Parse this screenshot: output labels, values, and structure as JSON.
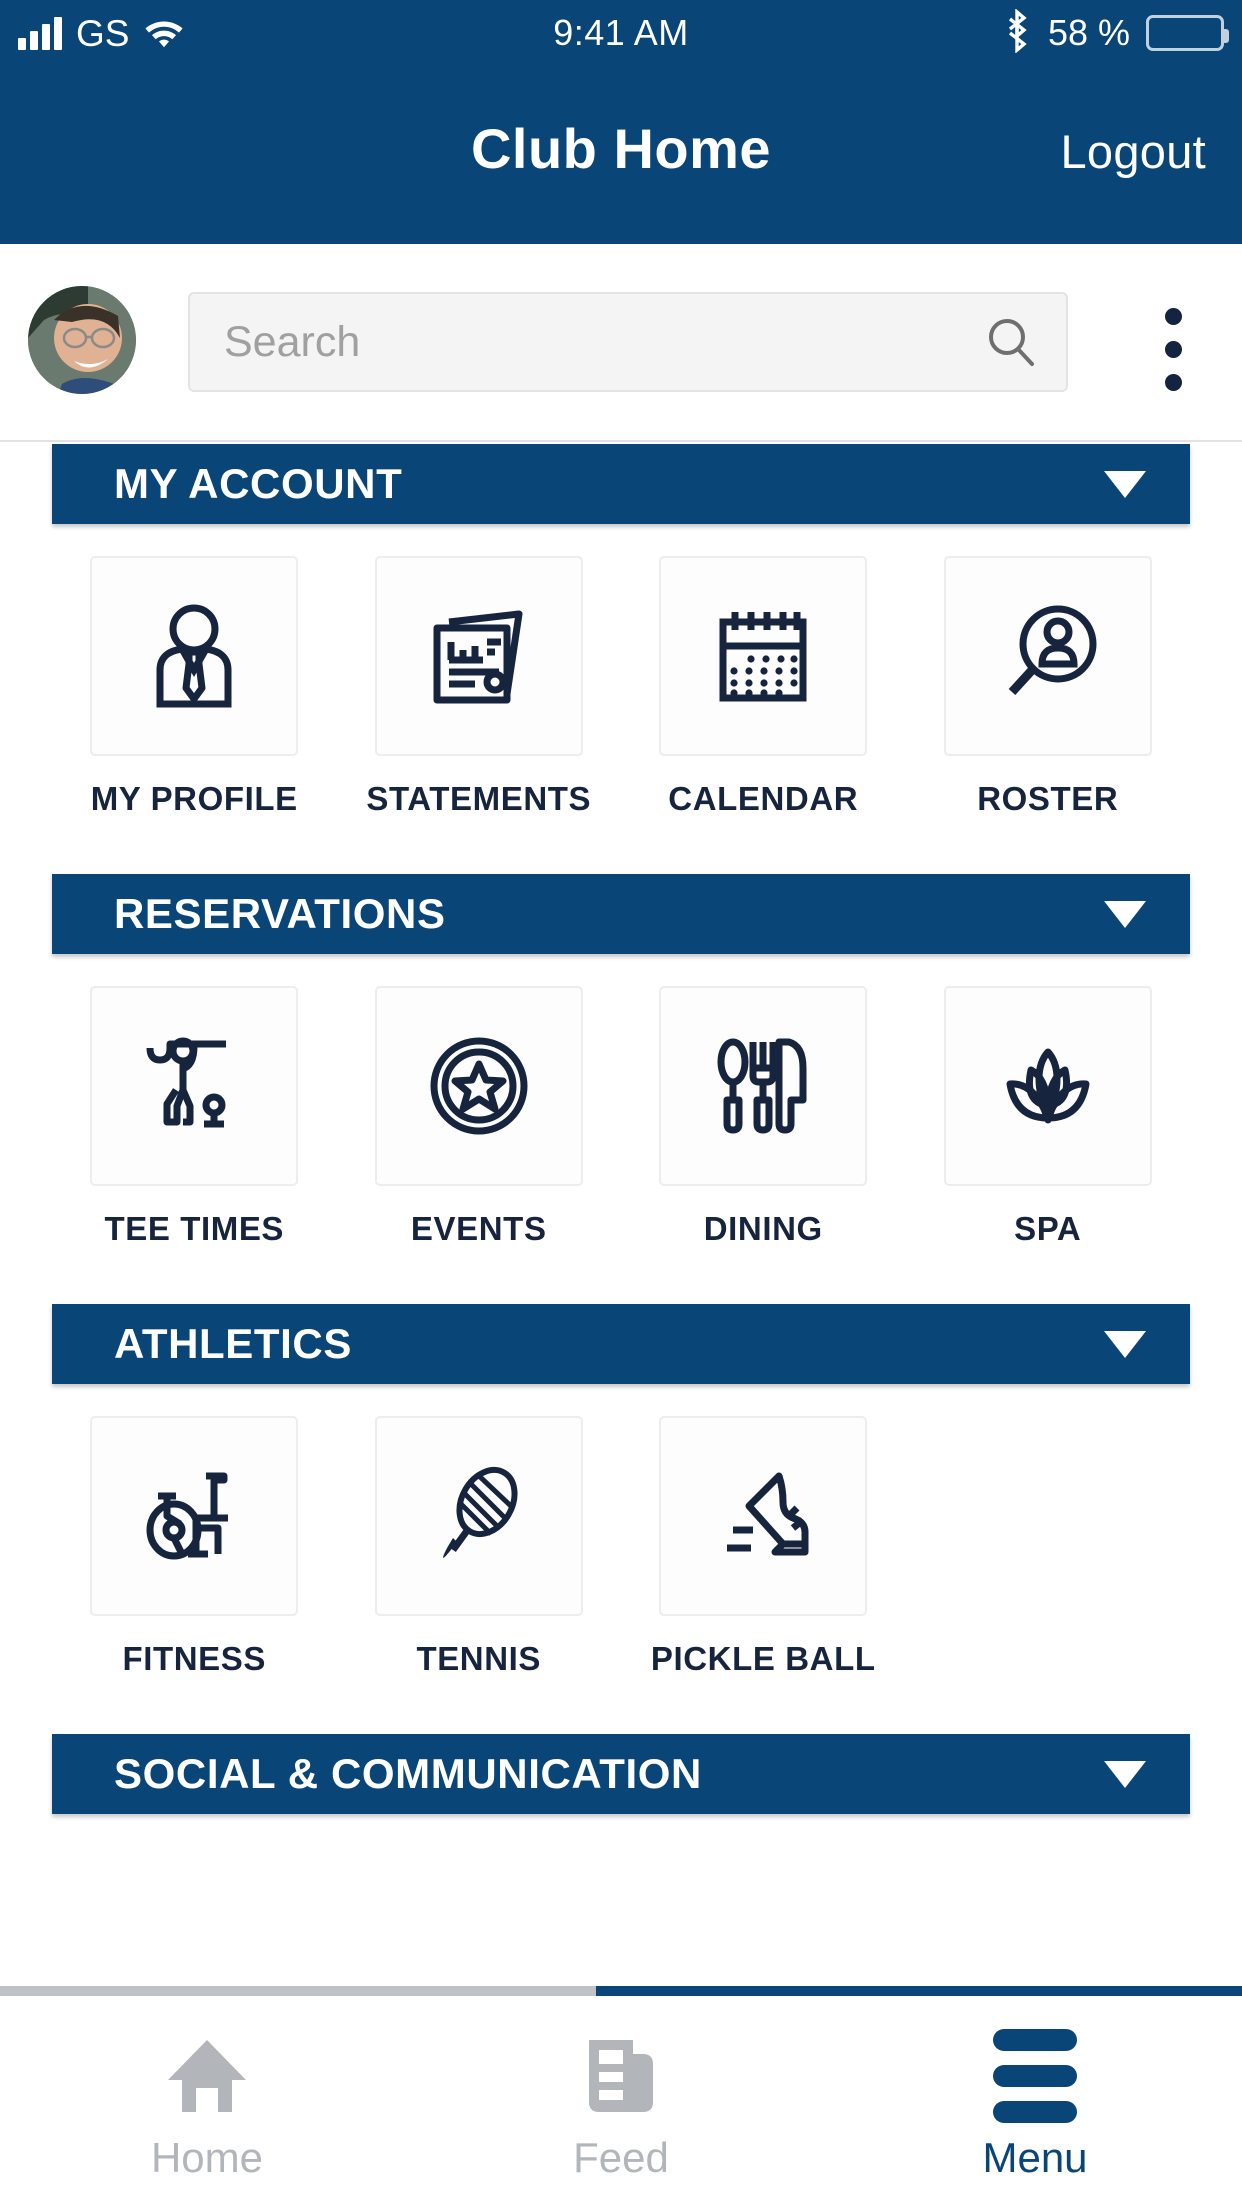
{
  "status_bar": {
    "carrier": "GS",
    "signal_icon": "signal-bars-icon",
    "wifi_icon": "wifi-icon",
    "time": "9:41 AM",
    "bluetooth_icon": "bluetooth-icon",
    "battery_percent": "58 %",
    "battery_level": 58,
    "battery_icon": "battery-icon"
  },
  "navbar": {
    "title": "Club Home",
    "logout_label": "Logout"
  },
  "search_row": {
    "avatar_name": "user-avatar",
    "search_placeholder": "Search",
    "search_value": "",
    "search_icon": "search-icon",
    "overflow_icon": "kebab-menu-icon"
  },
  "sections": [
    {
      "title": "MY ACCOUNT",
      "caret_icon": "chevron-down-icon",
      "expanded": true,
      "tiles": [
        {
          "label": "MY PROFILE",
          "icon": "person-tie-icon"
        },
        {
          "label": "STATEMENTS",
          "icon": "documents-chart-icon"
        },
        {
          "label": "CALENDAR",
          "icon": "calendar-icon"
        },
        {
          "label": "ROSTER",
          "icon": "magnifier-person-icon"
        }
      ]
    },
    {
      "title": "RESERVATIONS",
      "caret_icon": "chevron-down-icon",
      "expanded": true,
      "tiles": [
        {
          "label": "TEE TIMES",
          "icon": "golfer-icon"
        },
        {
          "label": "EVENTS",
          "icon": "star-badge-icon"
        },
        {
          "label": "DINING",
          "icon": "cutlery-icon"
        },
        {
          "label": "SPA",
          "icon": "lotus-icon"
        }
      ]
    },
    {
      "title": "ATHLETICS",
      "caret_icon": "chevron-down-icon",
      "expanded": true,
      "tiles": [
        {
          "label": "FITNESS",
          "icon": "exercise-bike-icon"
        },
        {
          "label": "TENNIS",
          "icon": "tennis-racket-icon"
        },
        {
          "label": "PICKLE BALL",
          "icon": "running-shoe-icon"
        }
      ]
    },
    {
      "title": "SOCIAL & COMMUNICATION",
      "caret_icon": "chevron-down-icon",
      "expanded": true,
      "tiles": []
    }
  ],
  "tabbar": {
    "tabs": [
      {
        "label": "Home",
        "icon": "home-icon",
        "active": false
      },
      {
        "label": "Feed",
        "icon": "feed-icon",
        "active": false
      },
      {
        "label": "Menu",
        "icon": "hamburger-menu-icon",
        "active": true
      }
    ]
  },
  "colors": {
    "brand_blue": "#0a4578",
    "icon_navy": "#16243e",
    "inactive_grey": "#b2b6ba",
    "tile_border": "#ededed",
    "search_bg": "#f4f4f4"
  }
}
